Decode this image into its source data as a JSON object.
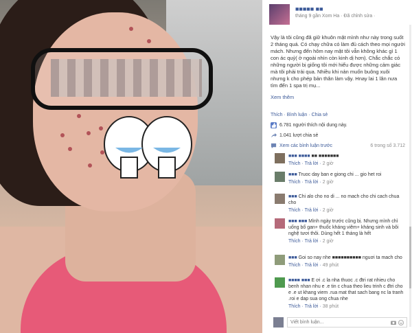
{
  "post": {
    "poster_name": "■■■■■ ■■",
    "meta_line": "tháng 9 gần Xom Ha · Đã chỉnh sửa ·",
    "text": "Vậy là tôi cũng đã giữ khuôn mặt mình như này trong suốt 2 tháng quá. Có chạy chữa có làm đủ cách theo mọi người mách. Nhưng đến hôm nay mặt tôi vẫn không khác gì 1 con ác quỷ( ở ngoài nhìn còn kinh dị hơn). Chắc chắc có những người bị giống tôi mới hiểu được những cảm giác mà tôi phải trải qua. Nhiều khi nản muốn buông xuôi nhưng k cho phép bản thân làm vậy. Hnay lai 1 lân nưa tìm đến 1 spa trị mụ...",
    "see_more": "Xem thêm"
  },
  "actions": {
    "like": "Thích",
    "comment": "Bình luận",
    "share": "Chia sẻ",
    "sep": " · "
  },
  "stats": {
    "likes": "6.781 người thích nội dung này.",
    "shares": "1.041 lượt chia sẻ",
    "view_prev": "Xem các bình luận trước",
    "count": "6 trong số 3.712"
  },
  "comments": [
    {
      "name": "■■■ ■■■■",
      "text": "■■ ■■■■■■■",
      "actions": "Thích · Trả lời ·",
      "time": "2 giờ"
    },
    {
      "name": "■■■",
      "text": "Truoc day ban e giong chi ... gio het roi",
      "actions": "Thích · Trả lời ·",
      "time": "2 giờ"
    },
    {
      "name": "■■■",
      "text": "Chi alo cho no di ... no mach cho chi cach chua cho",
      "actions": "Thích · Trả lời ·",
      "time": "2 giờ"
    },
    {
      "name": "■■■ ■■■",
      "text": "Mình ngày trước cũng bị. Nhưng mình chỉ uống bổ gan+ thuốc kháng viêm+ kháng sinh và bôi nghệ tươi thôi. Dùng hết 1 tháng là hết",
      "actions": "Thích · Trả lời ·",
      "time": "2 giờ"
    },
    {
      "name": "■■■",
      "text": "Goi so nay nhe ■■■■■■■■■■ nguơi ta mach cho",
      "actions": "Thích · Trả lời ·",
      "time": "49 phút"
    },
    {
      "name": "■■■■ ■■■",
      "text": "E ơi .c la nha thuoc .c đtri rat nhieu cho benh nhan nhu e .e tin c chua theo lieu trinh c đtri cho e .e ut khang viem .rua mat that sach bang nc la tranh .roi e dap sua ong chua nhe",
      "actions": "Thích · Trả lời ·",
      "time": "38 phút"
    }
  ],
  "compose": {
    "placeholder": "Viết bình luận..."
  },
  "icons": {
    "like": "thumbs-up-icon",
    "share": "share-icon",
    "comment": "speech-bubble-icon",
    "camera": "camera-icon",
    "emoji": "smiley-icon"
  },
  "colors": {
    "link": "#3b5998",
    "muted": "#8b8b8b"
  }
}
